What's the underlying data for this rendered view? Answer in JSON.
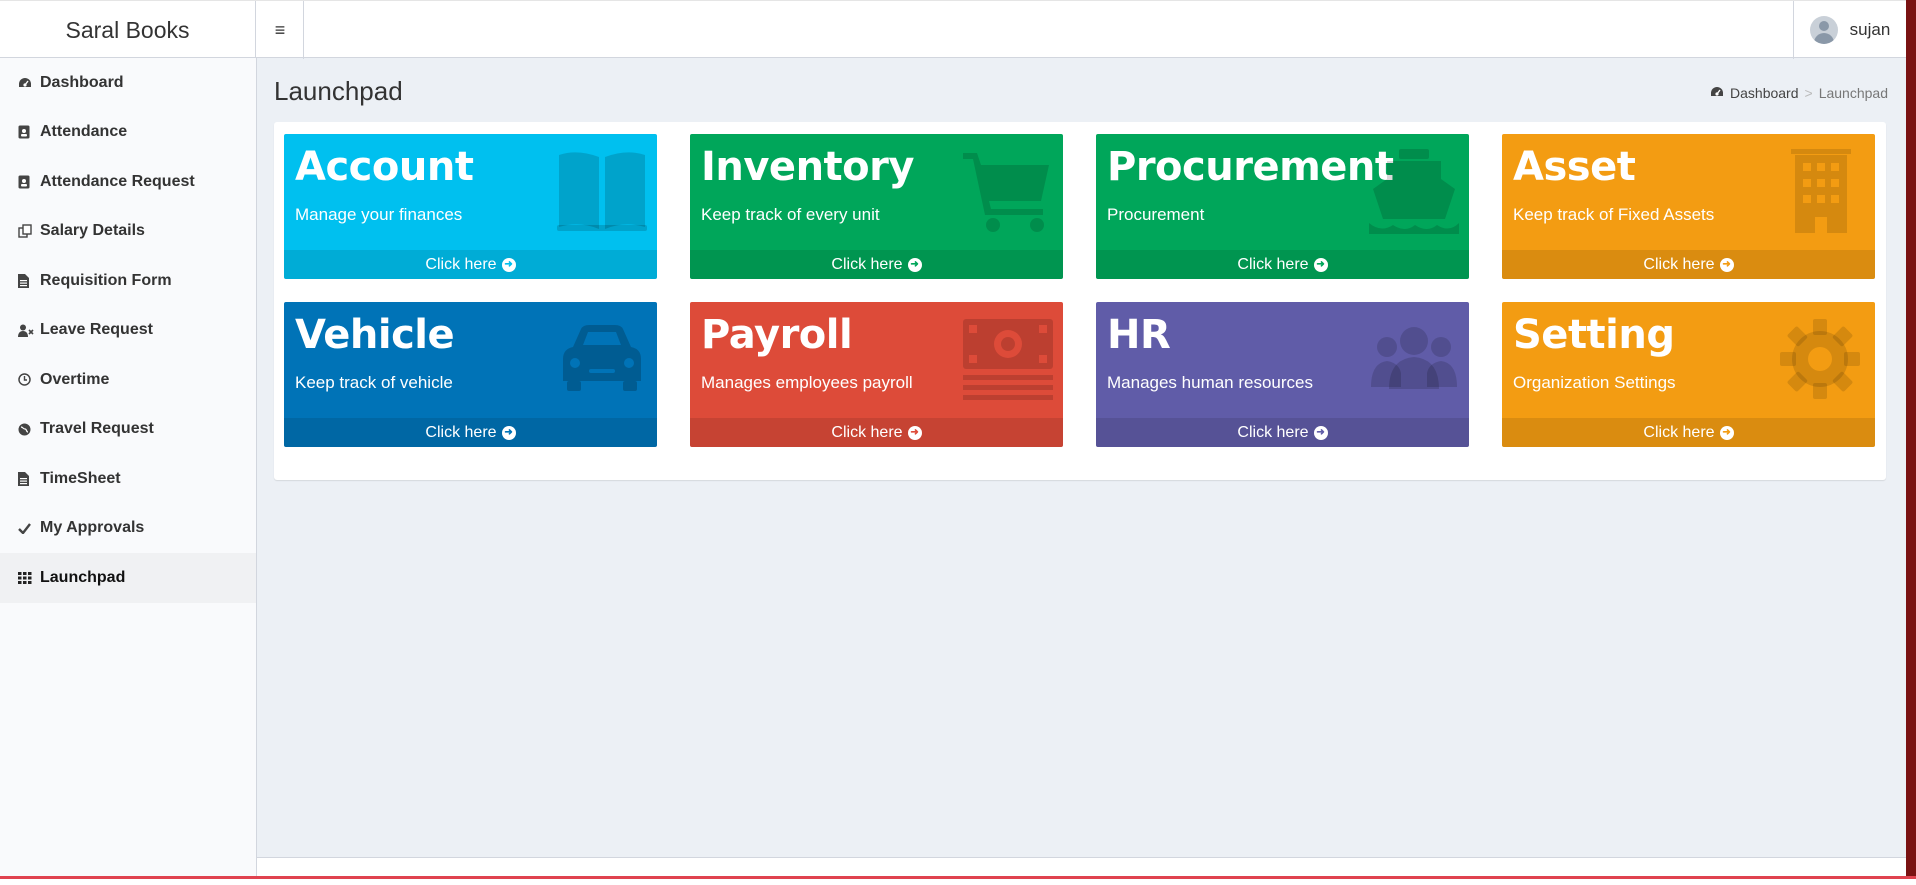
{
  "header": {
    "app_title": "Saral Books",
    "toggle_glyph": "≡",
    "username": "sujan"
  },
  "sidebar": {
    "items": [
      {
        "label": "Dashboard",
        "icon": "dashboard-icon"
      },
      {
        "label": "Attendance",
        "icon": "id-badge-icon"
      },
      {
        "label": "Attendance Request",
        "icon": "id-badge-icon"
      },
      {
        "label": "Salary Details",
        "icon": "copy-icon"
      },
      {
        "label": "Requisition Form",
        "icon": "file-icon"
      },
      {
        "label": "Leave Request",
        "icon": "user-times-icon"
      },
      {
        "label": "Overtime",
        "icon": "clock-icon"
      },
      {
        "label": "Travel Request",
        "icon": "globe-icon"
      },
      {
        "label": "TimeSheet",
        "icon": "file-icon"
      },
      {
        "label": "My Approvals",
        "icon": "check-icon"
      },
      {
        "label": "Launchpad",
        "icon": "grid-icon"
      }
    ],
    "active": "Launchpad"
  },
  "page": {
    "title": "Launchpad",
    "breadcrumb": {
      "home": "Dashboard",
      "current": "Launchpad",
      "separator": ">"
    }
  },
  "tiles": [
    {
      "title": "Account",
      "subtitle": "Manage your finances",
      "footer": "Click here",
      "color": "#00c0ef",
      "icon": "book-icon"
    },
    {
      "title": "Inventory",
      "subtitle": "Keep track of every unit",
      "footer": "Click here",
      "color": "#00a65a",
      "icon": "cart-icon"
    },
    {
      "title": "Procurement",
      "subtitle": "Procurement",
      "footer": "Click here",
      "color": "#00a65a",
      "icon": "ship-icon"
    },
    {
      "title": "Asset",
      "subtitle": "Keep track of Fixed Assets",
      "footer": "Click here",
      "color": "#f39c12",
      "icon": "building-icon"
    },
    {
      "title": "Vehicle",
      "subtitle": "Keep track of vehicle",
      "footer": "Click here",
      "color": "#0073b7",
      "icon": "car-icon"
    },
    {
      "title": "Payroll",
      "subtitle": "Manages employees payroll",
      "footer": "Click here",
      "color": "#dd4b39",
      "icon": "money-icon"
    },
    {
      "title": "HR",
      "subtitle": "Manages human resources",
      "footer": "Click here",
      "color": "#605ca8",
      "icon": "users-icon"
    },
    {
      "title": "Setting",
      "subtitle": "Organization Settings",
      "footer": "Click here",
      "color": "#f39c12",
      "icon": "gear-icon"
    }
  ]
}
